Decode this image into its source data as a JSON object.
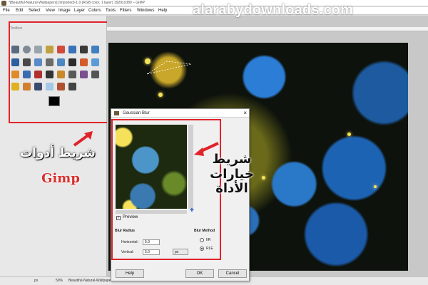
{
  "window": {
    "title": "*[Beautiful-Natural-Wallpapers] (imported)-1.0 (RGB color, 1 layer) 1920x1080 – GIMP"
  },
  "menu": {
    "items": [
      "File",
      "Edit",
      "Select",
      "View",
      "Image",
      "Layer",
      "Colors",
      "Tools",
      "Filters",
      "Windows",
      "Help"
    ]
  },
  "toolbox": {
    "label": "Toolbox"
  },
  "watermark": "alarabydownloads.com",
  "callouts": {
    "toolbox_ar": "شريط أدوات",
    "toolbox_en": "Gimp",
    "options_ar": "شريط خيارات الأداة"
  },
  "dialog": {
    "title": "Gaussian Blur",
    "close_glyph": "×",
    "preview_label": "Preview",
    "preview_checked": true,
    "blur_radius_label": "Blur Radius",
    "horizontal_label": "Horizontal:",
    "horizontal_value": "5.0",
    "vertical_label": "Vertical:",
    "vertical_value": "5.0",
    "unit": "px",
    "blur_method_label": "Blur Method",
    "method_options": [
      "IIR",
      "RLE"
    ],
    "method_selected": "RLE",
    "help_button": "Help",
    "ok_button": "OK",
    "cancel_button": "Cancel"
  },
  "statusbar": {
    "units": "px",
    "zoom": "50%",
    "layer_text": "Beautiful-Natural-Wallpapers"
  },
  "colors": {
    "highlight": "#e0232b",
    "callout_red": "#d9302e"
  },
  "icons": [
    "gimp-app-icon",
    "select-rect-icon",
    "select-ellipse-icon",
    "lasso-icon",
    "fuzzy-select-icon",
    "scissors-icon",
    "paths-icon",
    "color-picker-icon",
    "zoom-icon",
    "measure-icon",
    "move-icon",
    "align-icon",
    "crop-icon",
    "rotate-icon",
    "text-icon",
    "bucket-fill-icon",
    "blend-icon",
    "pencil-icon",
    "paintbrush-icon",
    "eraser-icon",
    "airbrush-icon",
    "ink-icon",
    "clone-icon",
    "heal-icon",
    "smudge-icon",
    "dodge-burn-icon",
    "blur-icon",
    "foreground-color-icon",
    "background-color-icon",
    "close-icon",
    "nav-cross-icon",
    "arrow-icon"
  ]
}
